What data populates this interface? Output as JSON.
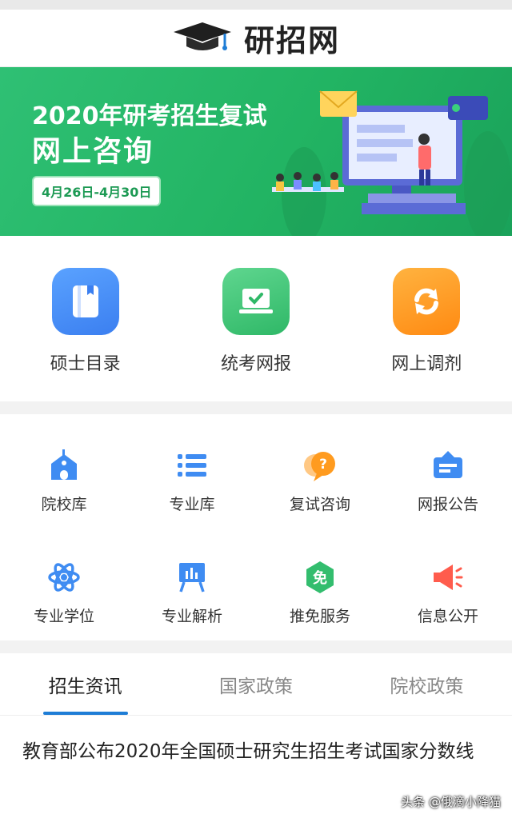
{
  "header": {
    "title": "研招网",
    "logo_icon": "graduation-cap-icon"
  },
  "banner": {
    "line1": "2020年研考招生复试",
    "line2": "网上咨询",
    "date_range": "4月26日-4月30日"
  },
  "primary_actions": [
    {
      "label": "硕士目录",
      "icon": "book-icon",
      "color": "#3f8cf2"
    },
    {
      "label": "统考网报",
      "icon": "laptop-check-icon",
      "color": "#33bd6e"
    },
    {
      "label": "网上调剂",
      "icon": "refresh-icon",
      "color": "#ff9b1f"
    }
  ],
  "services": [
    {
      "label": "院校库",
      "icon": "school-icon"
    },
    {
      "label": "专业库",
      "icon": "list-icon"
    },
    {
      "label": "复试咨询",
      "icon": "question-bubble-icon"
    },
    {
      "label": "网报公告",
      "icon": "notice-board-icon"
    },
    {
      "label": "专业学位",
      "icon": "atom-icon"
    },
    {
      "label": "专业解析",
      "icon": "chart-board-icon"
    },
    {
      "label": "推免服务",
      "icon": "exempt-badge-icon",
      "badge_text": "免"
    },
    {
      "label": "信息公开",
      "icon": "megaphone-icon"
    }
  ],
  "tabs": [
    {
      "label": "招生资讯",
      "active": true
    },
    {
      "label": "国家政策",
      "active": false
    },
    {
      "label": "院校政策",
      "active": false
    }
  ],
  "news": [
    {
      "title": "教育部公布2020年全国硕士研究生招生考试国家分数线"
    }
  ],
  "watermark": "头条 @俄滴小降猫",
  "colors": {
    "brand_blue": "#1e7dd6",
    "banner_green": "#22b463"
  }
}
